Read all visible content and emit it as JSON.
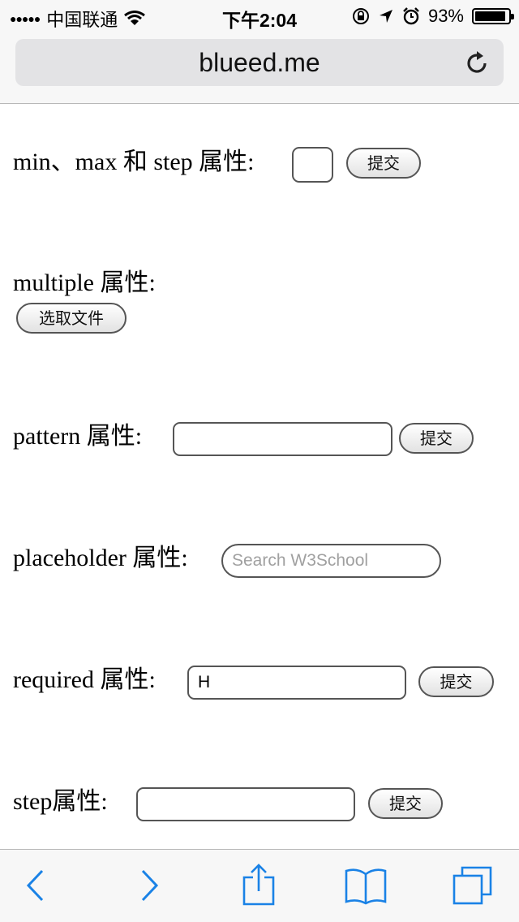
{
  "status_bar": {
    "signal": "●●●●●",
    "carrier": "中国联通",
    "time": "下午2:04",
    "battery": "93%",
    "battery_level": 0.93
  },
  "browser": {
    "url": "blueed.me"
  },
  "form": {
    "min_max_step": {
      "label": "min、max 和 step 属性:",
      "submit": "提交",
      "value": ""
    },
    "multiple": {
      "label": "multiple 属性:",
      "choose_file": "选取文件"
    },
    "pattern": {
      "label": "pattern 属性:",
      "submit": "提交",
      "value": ""
    },
    "placeholder": {
      "label": "placeholder 属性:",
      "placeholder": "Search W3School"
    },
    "required": {
      "label": "required 属性:",
      "value": "H",
      "submit": "提交"
    },
    "step": {
      "label": "step属性:",
      "submit": "提交",
      "value": ""
    }
  },
  "colors": {
    "ios_blue": "#1a82e6",
    "bar_bg": "#f7f7f7",
    "url_field_bg": "#e3e3e5"
  },
  "toolbar": {
    "icons": [
      "back-icon",
      "forward-icon",
      "share-icon",
      "bookmarks-icon",
      "tabs-icon"
    ]
  }
}
